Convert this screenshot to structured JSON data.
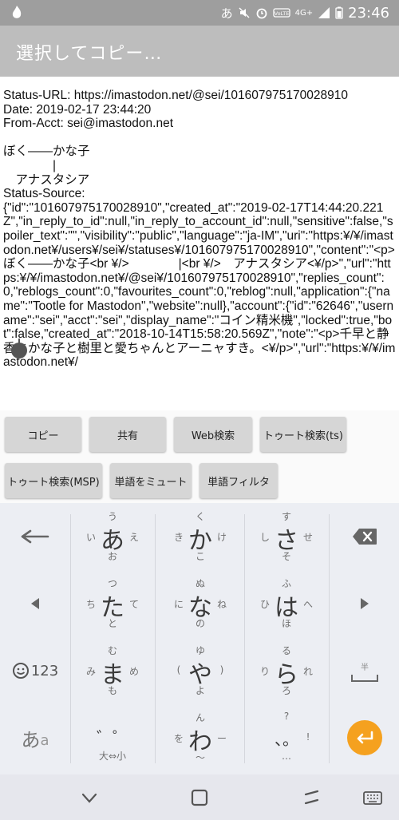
{
  "status_bar": {
    "time": "23:46",
    "ime_indicator": "あ",
    "network_label": "4G+",
    "colors": {
      "background": "#9e9e9e",
      "icons": "#ffffff"
    }
  },
  "title_bar": {
    "title": "選択してコピー…",
    "colors": {
      "background": "#bdbdbd",
      "text": "#ffffff"
    }
  },
  "content": {
    "text": "Status-URL: https://imastodon.net/@sei/101607975170028910\nDate: 2019-02-17 23:44:20\nFrom-Acct: sei@imastodon.net\n\nぼく――かな子\n　　　　|\n　アナスタシア\nStatus-Source:\n{\"id\":\"101607975170028910\",\"created_at\":\"2019-02-17T14:44:20.221Z\",\"in_reply_to_id\":null,\"in_reply_to_account_id\":null,\"sensitive\":false,\"spoiler_text\":\"\",\"visibility\":\"public\",\"language\":\"ja-IM\",\"uri\":\"https:¥/¥/imastodon.net¥/users¥/sei¥/statuses¥/101607975170028910\",\"content\":\"<p>ぼく――かな子<br ¥/>　　　　|<br ¥/>　アナスタシア<¥/p>\",\"url\":\"https:¥/¥/imastodon.net¥/@sei¥/101607975170028910\",\"replies_count\":0,\"reblogs_count\":0,\"favourites_count\":0,\"reblog\":null,\"application\":{\"name\":\"Tootle for Mastodon\",\"website\":null},\"account\":{\"id\":\"62646\",\"username\":\"sei\",\"acct\":\"sei\",\"display_name\":\"コイン精米機\",\"locked\":true,\"bot\":false,\"created_at\":\"2018-10-14T15:58:20.569Z\",\"note\":\"<p>千早と静香とかな子と樹里と愛ちゃんとアーニャすき。<¥/p>\",\"url\":\"https:¥/¥/imastodon.net¥/"
  },
  "actions": {
    "copy": "コピー",
    "share": "共有",
    "web_search": "Web検索",
    "toot_search_ts": "トゥート検索(ts)",
    "toot_search_msp": "トゥート検索(MSP)",
    "mute_word": "単語をミュート",
    "word_filter": "単語フィルタ"
  },
  "keyboard": {
    "icons": {
      "undo": "undo-arrow-icon",
      "backspace": "backspace-icon",
      "cursor_left": "triangle-left-icon",
      "cursor_right": "triangle-right-icon",
      "emoji": "smiley-icon",
      "space": "space-bar-icon",
      "enter": "enter-arrow-icon"
    },
    "emoji_mode_label": "123",
    "lang_label_main": "あ",
    "lang_label_sub": "a",
    "space_hint": "半",
    "keys": [
      {
        "main": "あ",
        "up": "う",
        "left": "い",
        "right": "え",
        "down": "お"
      },
      {
        "main": "か",
        "up": "く",
        "left": "き",
        "right": "け",
        "down": "こ"
      },
      {
        "main": "さ",
        "up": "す",
        "left": "し",
        "right": "せ",
        "down": "そ"
      },
      {
        "main": "た",
        "up": "つ",
        "left": "ち",
        "right": "て",
        "down": "と"
      },
      {
        "main": "な",
        "up": "ぬ",
        "left": "に",
        "right": "ね",
        "down": "の"
      },
      {
        "main": "は",
        "up": "ふ",
        "left": "ひ",
        "right": "へ",
        "down": "ほ"
      },
      {
        "main": "ま",
        "up": "む",
        "left": "み",
        "right": "め",
        "down": "も"
      },
      {
        "main": "や",
        "up": "ゆ",
        "left": "(",
        "right": ")",
        "down": "よ"
      },
      {
        "main": "ら",
        "up": "る",
        "left": "り",
        "right": "れ",
        "down": "ろ"
      },
      {
        "main": "゛゜",
        "up": "",
        "left": "",
        "right": "",
        "down": "大⇔小"
      },
      {
        "main": "わ",
        "up": "ん",
        "left": "を",
        "right": "ー",
        "down": "～"
      },
      {
        "main": "、。",
        "up": "?",
        "left": "",
        "right": "!",
        "down": "…"
      }
    ],
    "colors": {
      "background": "#eceef3",
      "enter": "#f5a11f"
    }
  },
  "nav_bar": {
    "icons": {
      "back": "back-chevron-icon",
      "home": "home-square-icon",
      "recents": "recents-icon",
      "keyboard": "keyboard-icon"
    },
    "colors": {
      "background": "#e6e7ed"
    }
  }
}
